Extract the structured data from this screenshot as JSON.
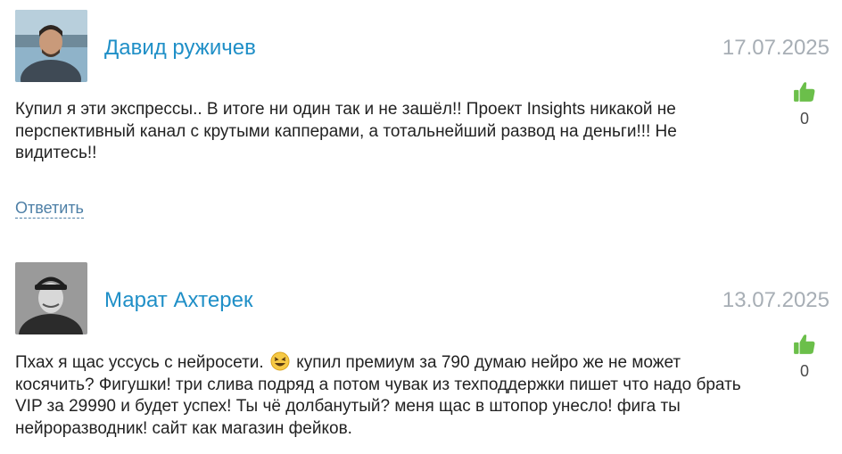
{
  "comments": [
    {
      "author": "Давид ружичев",
      "date": "17.07.2025",
      "text": "Купил я эти экспрессы.. В итоге ни один так и не зашёл!! Проект Insights никакой не перспективный канал с крутыми капперами, а тотальнейший развод на деньги!!! Не видитесь!!",
      "likes": "0",
      "reply_label": "Ответить"
    },
    {
      "author": "Марат Ахтерек",
      "date": "13.07.2025",
      "text_before_emoji": "Пхах я щас уссусь с нейросети.",
      "text_after_emoji": "купил премиум за 790 думаю нейро же не может косячить? Фигушки! три слива подряд а потом чувак из техподдержки пишет что надо брать VIP за 29990 и будет успех! Ты чё долбанутый? меня щас в штопор унесло! фига ты нейроразводник! сайт как магазин фейков.",
      "likes": "0"
    }
  ],
  "icons": {
    "like": "thumbs-up-icon",
    "emoji": "laughing-face-icon"
  },
  "colors": {
    "author": "#1f8fc7",
    "date": "#a7aeb5",
    "like": "#6bbf4a",
    "reply": "#4d7fa6"
  }
}
